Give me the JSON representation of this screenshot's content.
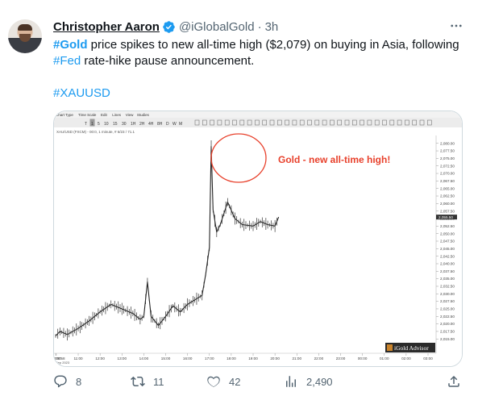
{
  "tweet": {
    "author": {
      "display_name": "Christopher Aaron",
      "handle": "@iGlobalGold",
      "separator": "·",
      "time": "3h"
    },
    "text": {
      "hashtag_gold": "#Gold",
      "part1": " price spikes to new all-time high ($2,079) on buying in Asia, following ",
      "hashtag_fed": "#Fed",
      "part2": " rate-hike pause announcement.",
      "hashtag_xauusd": "#XAUUSD"
    },
    "more_icon": "more-icon",
    "verified_icon": "verified-badge-icon"
  },
  "chart": {
    "menu": [
      "Chart Type",
      "Time Scale",
      "Edit",
      "Lines",
      "View",
      "Studies"
    ],
    "toolbar_timeframes": [
      "T",
      "1",
      "5",
      "10",
      "15",
      "30",
      "1H",
      "2H",
      "4H",
      "8H",
      "D",
      "W",
      "M"
    ],
    "symbol_line": "XAU/USD (FXCM) - 00:0, 1 minute, # 6/23 / 71.1",
    "annotation": "Gold - new all-time high!",
    "watermark": "iGold Advisor",
    "date_label": "Sep 2023"
  },
  "chart_data": {
    "type": "line",
    "title": "",
    "xlabel": "",
    "ylabel": "",
    "x_ticks": [
      "09:58",
      "10:00",
      "11:00",
      "12:00",
      "13:00",
      "14:00",
      "15:00",
      "16:00",
      "17:00",
      "18:00",
      "19:00",
      "20:00",
      "21:00",
      "22:00",
      "23:00",
      "00:00",
      "01:00",
      "02:00",
      "03:00"
    ],
    "y_ticks": [
      2080.0,
      2077.5,
      2075.0,
      2072.5,
      2070.0,
      2067.5,
      2065.0,
      2062.5,
      2060.0,
      2057.5,
      2055.0,
      2052.5,
      2050.0,
      2047.5,
      2045.0,
      2042.5,
      2040.0,
      2037.5,
      2035.0,
      2032.5,
      2030.0,
      2027.5,
      2025.0,
      2022.5,
      2020.0,
      2017.5,
      2015.0
    ],
    "ylim": [
      2014.0,
      2081.0
    ],
    "last_price": 2055.5,
    "series": [
      {
        "values": [
          {
            "t": "09:58",
            "v": 2016.0
          },
          {
            "t": "10:10",
            "v": 2017.5
          },
          {
            "t": "10:30",
            "v": 2016.5
          },
          {
            "t": "11:00",
            "v": 2018.5
          },
          {
            "t": "11:30",
            "v": 2021.0
          },
          {
            "t": "12:00",
            "v": 2024.0
          },
          {
            "t": "12:30",
            "v": 2026.5
          },
          {
            "t": "13:00",
            "v": 2025.0
          },
          {
            "t": "13:30",
            "v": 2023.5
          },
          {
            "t": "13:50",
            "v": 2021.5
          },
          {
            "t": "14:00",
            "v": 2022.5
          },
          {
            "t": "14:10",
            "v": 2034.0
          },
          {
            "t": "14:20",
            "v": 2022.5
          },
          {
            "t": "14:40",
            "v": 2019.5
          },
          {
            "t": "15:00",
            "v": 2022.5
          },
          {
            "t": "15:20",
            "v": 2026.0
          },
          {
            "t": "15:40",
            "v": 2024.0
          },
          {
            "t": "16:00",
            "v": 2026.5
          },
          {
            "t": "16:20",
            "v": 2028.0
          },
          {
            "t": "16:40",
            "v": 2029.5
          },
          {
            "t": "16:50",
            "v": 2036.5
          },
          {
            "t": "17:00",
            "v": 2045.5
          },
          {
            "t": "17:05",
            "v": 2079.0
          },
          {
            "t": "17:10",
            "v": 2058.0
          },
          {
            "t": "17:20",
            "v": 2050.5
          },
          {
            "t": "17:30",
            "v": 2053.0
          },
          {
            "t": "17:50",
            "v": 2060.5
          },
          {
            "t": "18:10",
            "v": 2055.0
          },
          {
            "t": "18:30",
            "v": 2053.0
          },
          {
            "t": "19:00",
            "v": 2052.5
          },
          {
            "t": "19:20",
            "v": 2054.0
          },
          {
            "t": "19:40",
            "v": 2053.0
          },
          {
            "t": "20:00",
            "v": 2052.5
          },
          {
            "t": "20:10",
            "v": 2055.5
          }
        ]
      }
    ],
    "grid": false,
    "colors": {
      "line": "#222222",
      "annotation": "#e8412c"
    }
  },
  "actions": {
    "replies": "8",
    "reposts": "11",
    "likes": "42",
    "views": "2,490"
  },
  "colors": {
    "link": "#1d9bf0",
    "verified": "#1d9bf0",
    "muted": "#536471",
    "annotation_red": "#e8412c"
  }
}
